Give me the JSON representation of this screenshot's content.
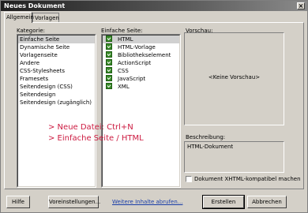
{
  "window": {
    "title": "Neues Dokument"
  },
  "tabs": [
    {
      "label": "Allgemein",
      "active": true
    },
    {
      "label": "Vorlagen",
      "active": false
    }
  ],
  "kategorie": {
    "label": "Kategorie:",
    "items": [
      "Einfache Seite",
      "Dynamische Seite",
      "Vorlagenseite",
      "Andere",
      "CSS-Stylesheets",
      "Framesets",
      "Seitendesign (CSS)",
      "Seitendesign",
      "Seitendesign (zugänglich)"
    ],
    "selected_index": 0
  },
  "einfache_seite": {
    "label": "Einfache Seite:",
    "items": [
      "HTML",
      "HTML-Vorlage",
      "Bibliothekselement",
      "ActionScript",
      "CSS",
      "JavaScript",
      "XML"
    ],
    "selected_index": 0,
    "item_icon": "document-check-icon"
  },
  "vorschau": {
    "label": "Vorschau:",
    "placeholder": "<Keine Vorschau>"
  },
  "beschreibung": {
    "label": "Beschreibung:",
    "text": "HTML-Dokument"
  },
  "xhtml_checkbox": {
    "label": "Dokument XHTML-kompatibel machen",
    "checked": false
  },
  "overlay": {
    "line1": "> Neue Datei: Ctrl+N",
    "line2": "> Einfache Seite / HTML",
    "color": "#cc1a40"
  },
  "footer": {
    "help": "Hilfe",
    "preferences": "Voreinstellungen...",
    "more_content": "Weitere Inhalte abrufen...",
    "create": "Erstellen",
    "cancel": "Abbrechen"
  }
}
